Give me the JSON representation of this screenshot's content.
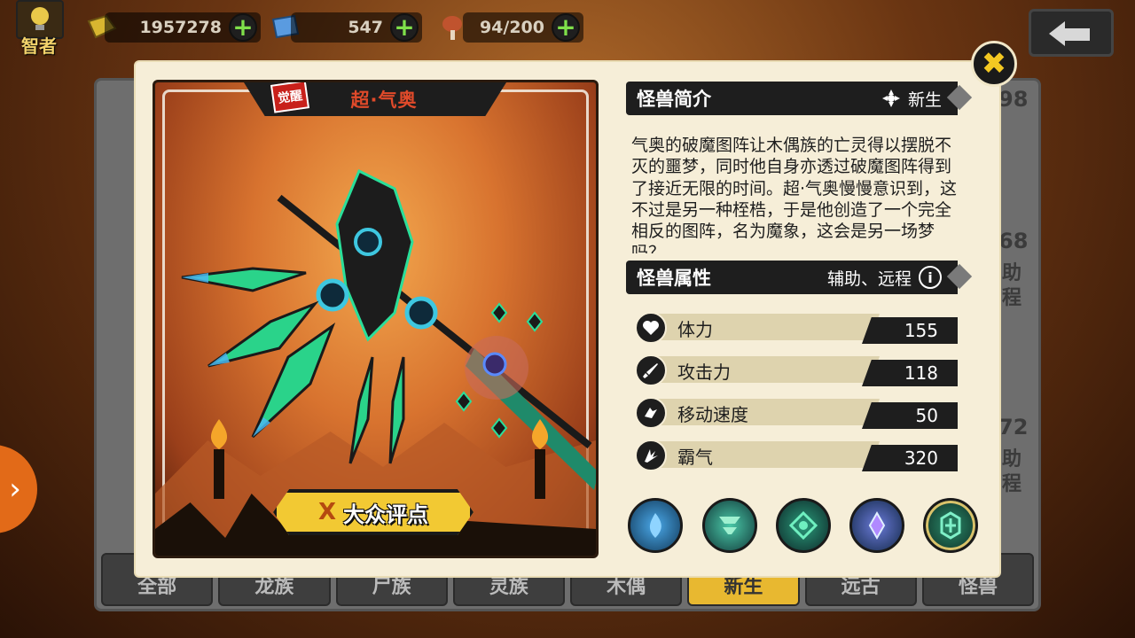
{
  "topbar": {
    "player_title": "智者",
    "gold": "1957278",
    "crystal": "547",
    "meat": "94/200",
    "plus_symbol": "+"
  },
  "background_panel": {
    "tabs": [
      "全部",
      "龙族",
      "尸族",
      "灵族",
      "木偶",
      "新生",
      "远古",
      "怪兽"
    ],
    "active_tab_index": 5,
    "right_numbers": [
      "98",
      "68",
      "72"
    ],
    "right_texts": [
      "助",
      "程",
      "助",
      "程"
    ]
  },
  "card": {
    "awaken_badge": "觉醒",
    "monster_name": "超·气奥",
    "rating_button": "大众评点",
    "rating_x": "X"
  },
  "intro": {
    "header": "怪兽简介",
    "race": "新生",
    "description": "气奥的破魔图阵让木偶族的亡灵得以摆脱不灭的噩梦，同时他自身亦透过破魔图阵得到了接近无限的时间。超·气奥慢慢意识到，这不过是另一种桎梏，于是他创造了一个完全相反的图阵，名为魔象，这会是另一场梦吗？"
  },
  "attributes": {
    "header": "怪兽属性",
    "types": "辅助、远程",
    "info_symbol": "i",
    "stats": [
      {
        "icon": "heart-icon",
        "label": "体力",
        "value": "155"
      },
      {
        "icon": "sword-icon",
        "label": "攻击力",
        "value": "118"
      },
      {
        "icon": "speed-icon",
        "label": "移动速度",
        "value": "50"
      },
      {
        "icon": "claw-icon",
        "label": "霸气",
        "value": "320"
      }
    ]
  },
  "skills": [
    {
      "icon": "blue-flame-skill-icon",
      "color": "#3a7fc0"
    },
    {
      "icon": "green-tornado-skill-icon",
      "color": "#2f8a7a"
    },
    {
      "icon": "green-rune-skill-icon",
      "color": "#1e6e5e"
    },
    {
      "icon": "purple-crystal-skill-icon",
      "color": "#3a5a8a"
    },
    {
      "icon": "green-glyph-skill-icon",
      "color": "#1d5a4a",
      "selected": true
    }
  ],
  "colors": {
    "accent_yellow": "#f2c933",
    "modal_bg": "#f6eed8",
    "dark": "#1e1e1e",
    "name_red": "#e04a2a"
  },
  "close_symbol": "✖",
  "side_arrow_symbol": "›"
}
